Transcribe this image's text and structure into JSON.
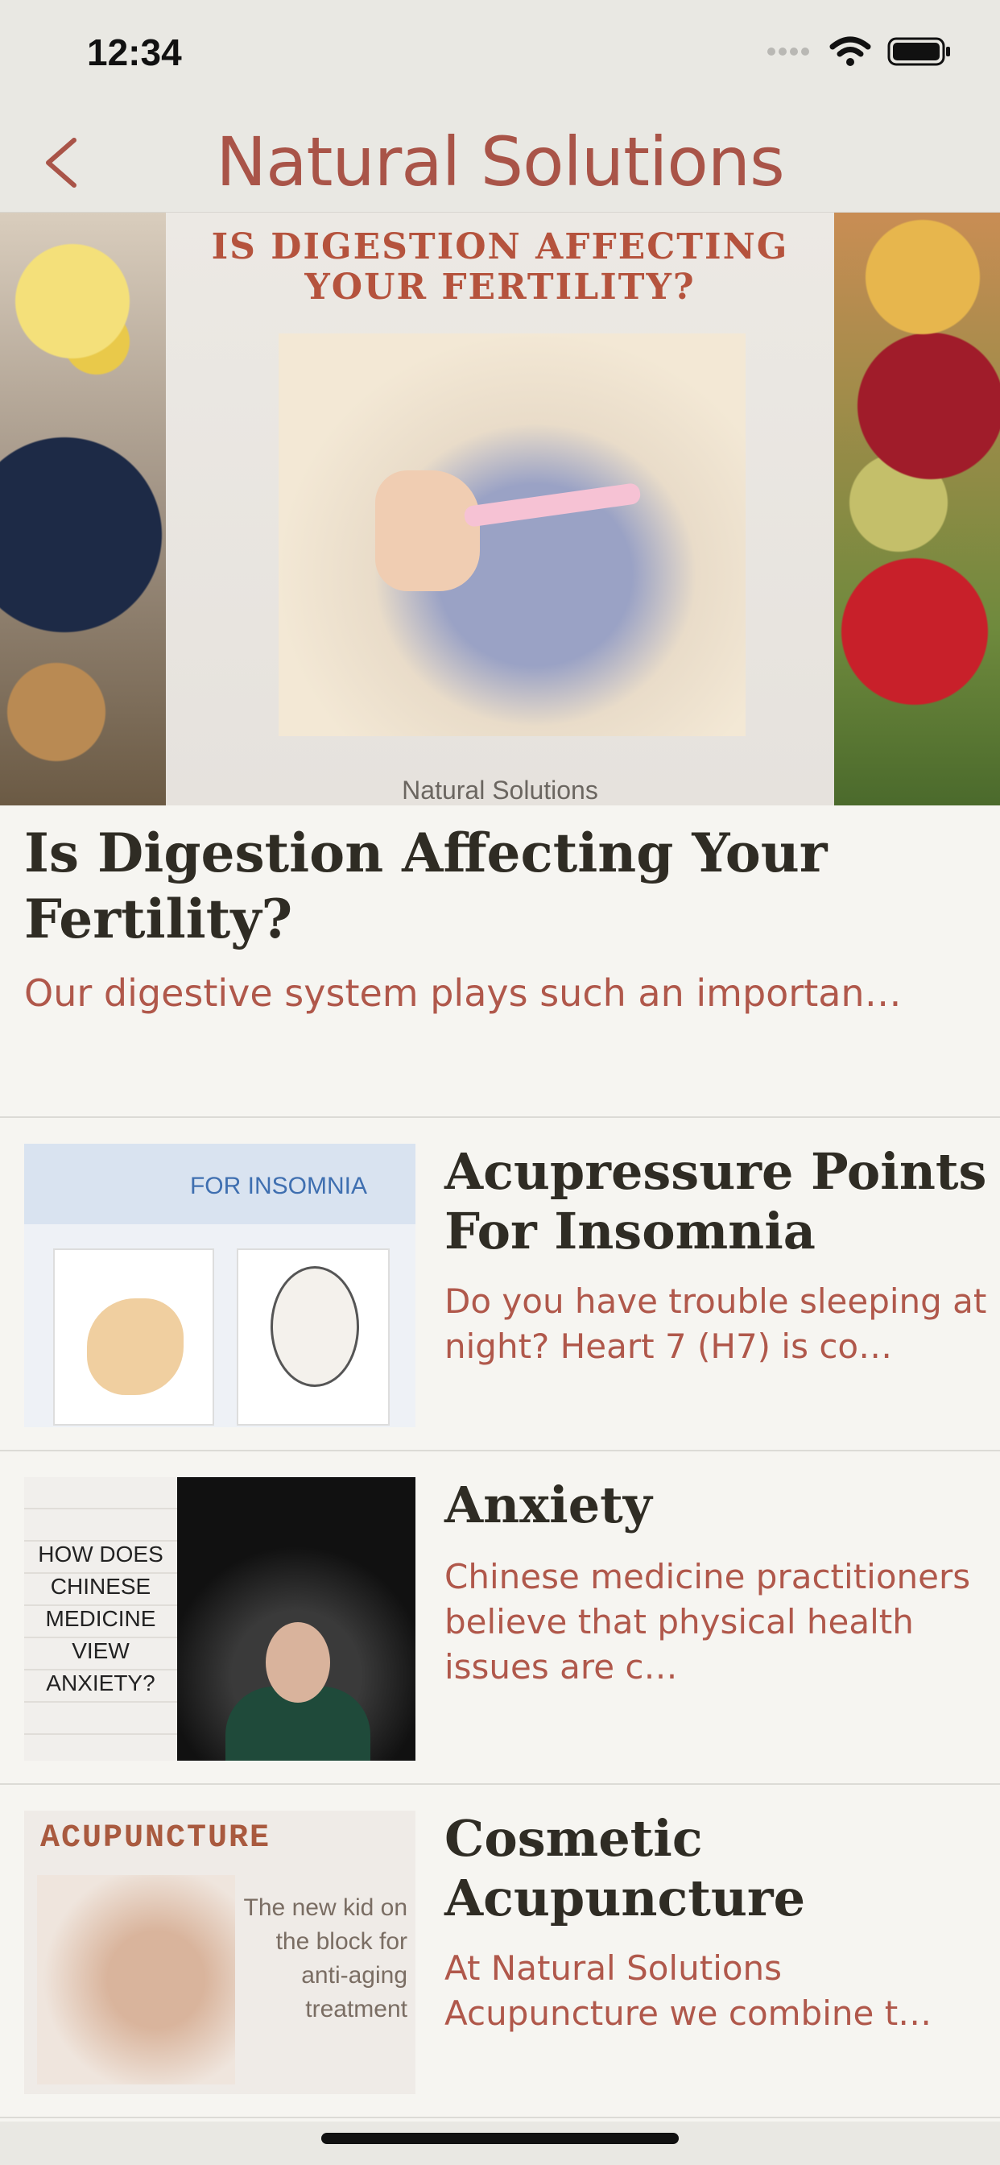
{
  "status_bar": {
    "time": "12:34"
  },
  "nav": {
    "title": "Natural Solutions",
    "back_icon": "chevron-left-icon"
  },
  "hero": {
    "headline": "IS DIGESTION AFFECTING YOUR FERTILITY?",
    "brand": "Natural Solutions"
  },
  "featured": {
    "title": "Is Digestion Affecting Your Fertility?",
    "excerpt": "Our digestive system plays such an importan…"
  },
  "articles": [
    {
      "title": "Acupressure Points For Insomnia",
      "excerpt": "Do you have trouble sleeping at night? Heart 7 (H7) is co…",
      "thumb_caption": "FOR INSOMNIA"
    },
    {
      "title": "Anxiety",
      "excerpt": "Chinese medicine practitioners believe that physical health issues are c…",
      "thumb_caption": "HOW DOES CHINESE MEDICINE VIEW ANXIETY?"
    },
    {
      "title": "Cosmetic Acupuncture",
      "excerpt": "At Natural Solutions Acupuncture we combine t…",
      "thumb_label": "ACUPUNCTURE",
      "thumb_caption": "The new kid on the block for anti-aging treatment"
    }
  ],
  "colors": {
    "accent": "#a95448",
    "title": "#2f2c24",
    "background": "#f6f5f1"
  }
}
